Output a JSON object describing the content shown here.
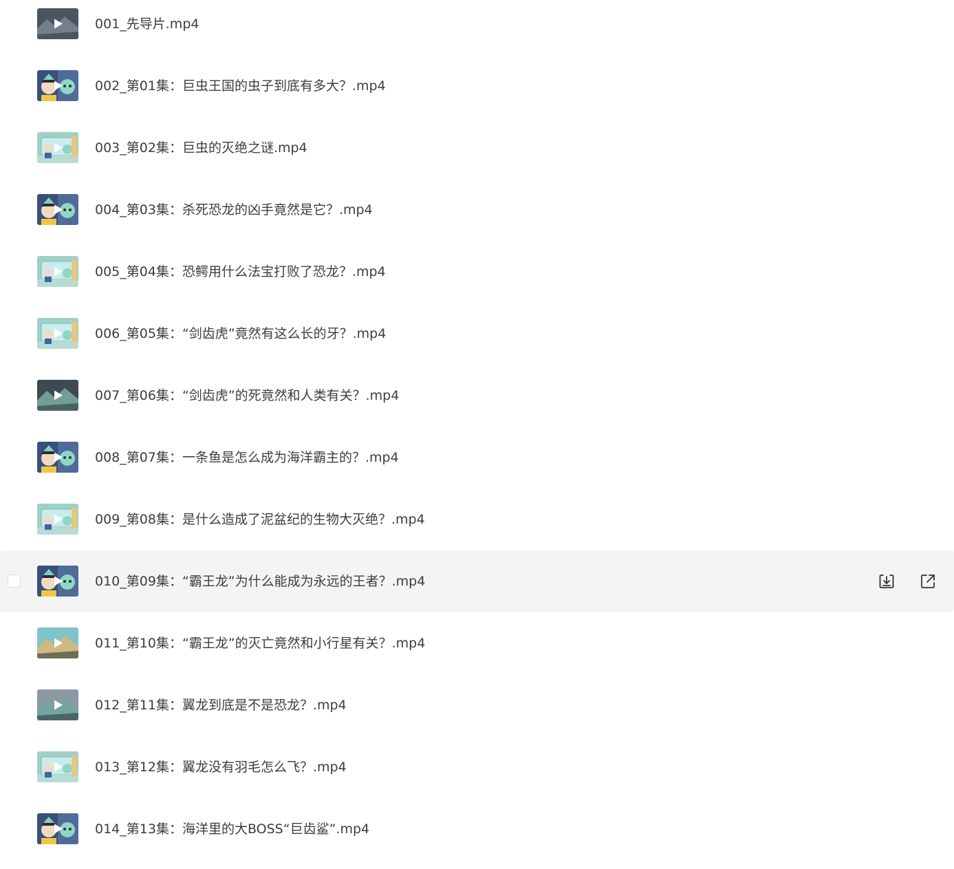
{
  "files": [
    {
      "name": "001_先导片.mp4",
      "thumb": {
        "bg": "#4a5560",
        "accent": "#7d8a96",
        "icon": "video-thumbnail-scene"
      },
      "hovered": false
    },
    {
      "name": "002_第01集：巨虫王国的虫子到底有多大？.mp4",
      "thumb": {
        "bg": "#3a4f7a",
        "accent": "#8fd6c4",
        "icon": "video-thumbnail-characters"
      },
      "hovered": false
    },
    {
      "name": "003_第02集：巨虫的灭绝之谜.mp4",
      "thumb": {
        "bg": "#9fd1c7",
        "accent": "#e9c77c",
        "icon": "video-thumbnail-aquarium"
      },
      "hovered": false
    },
    {
      "name": "004_第03集：杀死恐龙的凶手竟然是它？.mp4",
      "thumb": {
        "bg": "#3a4f7a",
        "accent": "#8fd6c4",
        "icon": "video-thumbnail-characters"
      },
      "hovered": false
    },
    {
      "name": "005_第04集：恐鳄用什么法宝打败了恐龙？.mp4",
      "thumb": {
        "bg": "#9fd1c7",
        "accent": "#e9c77c",
        "icon": "video-thumbnail-aquarium"
      },
      "hovered": false
    },
    {
      "name": "006_第05集：“剑齿虎”竟然有这么长的牙？.mp4",
      "thumb": {
        "bg": "#9fd1c7",
        "accent": "#e9c77c",
        "icon": "video-thumbnail-aquarium"
      },
      "hovered": false
    },
    {
      "name": "007_第06集：“剑齿虎”的死竟然和人类有关？.mp4",
      "thumb": {
        "bg": "#3e4a52",
        "accent": "#7fb3a8",
        "icon": "video-thumbnail-scene"
      },
      "hovered": false
    },
    {
      "name": "008_第07集：一条鱼是怎么成为海洋霸主的？.mp4",
      "thumb": {
        "bg": "#3a4f7a",
        "accent": "#8fd6c4",
        "icon": "video-thumbnail-characters"
      },
      "hovered": false
    },
    {
      "name": "009_第08集：是什么造成了泥盆纪的生物大灭绝？.mp4",
      "thumb": {
        "bg": "#9fd1c7",
        "accent": "#e9c77c",
        "icon": "video-thumbnail-aquarium"
      },
      "hovered": false
    },
    {
      "name": "010_第09集：“霸王龙”为什么能成为永远的王者？.mp4",
      "thumb": {
        "bg": "#3a4f7a",
        "accent": "#8fd6c4",
        "icon": "video-thumbnail-characters"
      },
      "hovered": true
    },
    {
      "name": "011_第10集：“霸王龙”的灭亡竟然和小行星有关？.mp4",
      "thumb": {
        "bg": "#7fc4c9",
        "accent": "#e3b86d",
        "icon": "video-thumbnail-scene"
      },
      "hovered": false
    },
    {
      "name": "012_第11集：翼龙到底是不是恐龙？.mp4",
      "thumb": {
        "bg": "#8a9aa5",
        "accent": "#6fa8a0",
        "icon": "video-thumbnail-scene"
      },
      "hovered": false
    },
    {
      "name": "013_第12集：翼龙没有羽毛怎么飞？.mp4",
      "thumb": {
        "bg": "#9fd1c7",
        "accent": "#e9c77c",
        "icon": "video-thumbnail-aquarium"
      },
      "hovered": false
    },
    {
      "name": "014_第13集：海洋里的大BOSS“巨齿鲨”.mp4",
      "thumb": {
        "bg": "#3a4f7a",
        "accent": "#8fd6c4",
        "icon": "video-thumbnail-characters"
      },
      "hovered": false
    }
  ],
  "actions": {
    "download_icon": "download-icon",
    "open_icon": "open-external-icon"
  },
  "colors": {
    "text": "#3d3d3d",
    "hover_bg": "#f4f4f5",
    "icon": "#333333"
  }
}
